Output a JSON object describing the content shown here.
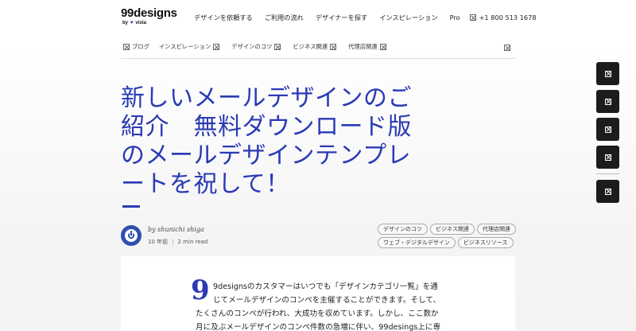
{
  "header": {
    "logo_main": "99designs",
    "logo_by": "by",
    "logo_brand": "vista",
    "nav": [
      "デザインを依頼する",
      "ご利用の流れ",
      "デザイナーを探す",
      "インスピレーション",
      "Pro"
    ],
    "phone": "+1 800 513 1678"
  },
  "subnav": {
    "items": [
      "ブログ",
      "インスピレーション",
      "デザインのコツ",
      "ビジネス関連",
      "代理店関連"
    ]
  },
  "article": {
    "title_lines": [
      "新しいメールデザインのご",
      "紹介　無料ダウンロード版",
      "のメールデザインテンプレ",
      "ートを祝して！"
    ],
    "author": "by shunichi shiga",
    "posted": "10 年前",
    "read_time": "2 min read",
    "tags_row1": [
      "デザインのコツ",
      "ビジネス関連",
      "代理店関連"
    ],
    "tags_row2": [
      "ウェブ・デジタルデザイン",
      "ビジネスリソース"
    ],
    "drop_cap": "9",
    "body_lines": [
      "9designsのカスタマーはいつでも「デザインカテゴリ一覧」を通",
      "じてメールデザインのコンペを主催することができます。そして、",
      "たくさんのコンペが行われ、大成功を収めています。しかし、ここ数か",
      "月に及ぶメールデザインのコンペ件数の急増に伴い、99desings上に専"
    ]
  },
  "colors": {
    "accent": "#2a3ab5",
    "share_bg": "#1c1c1c"
  },
  "icons": {
    "broken_image": "broken-image-icon"
  }
}
